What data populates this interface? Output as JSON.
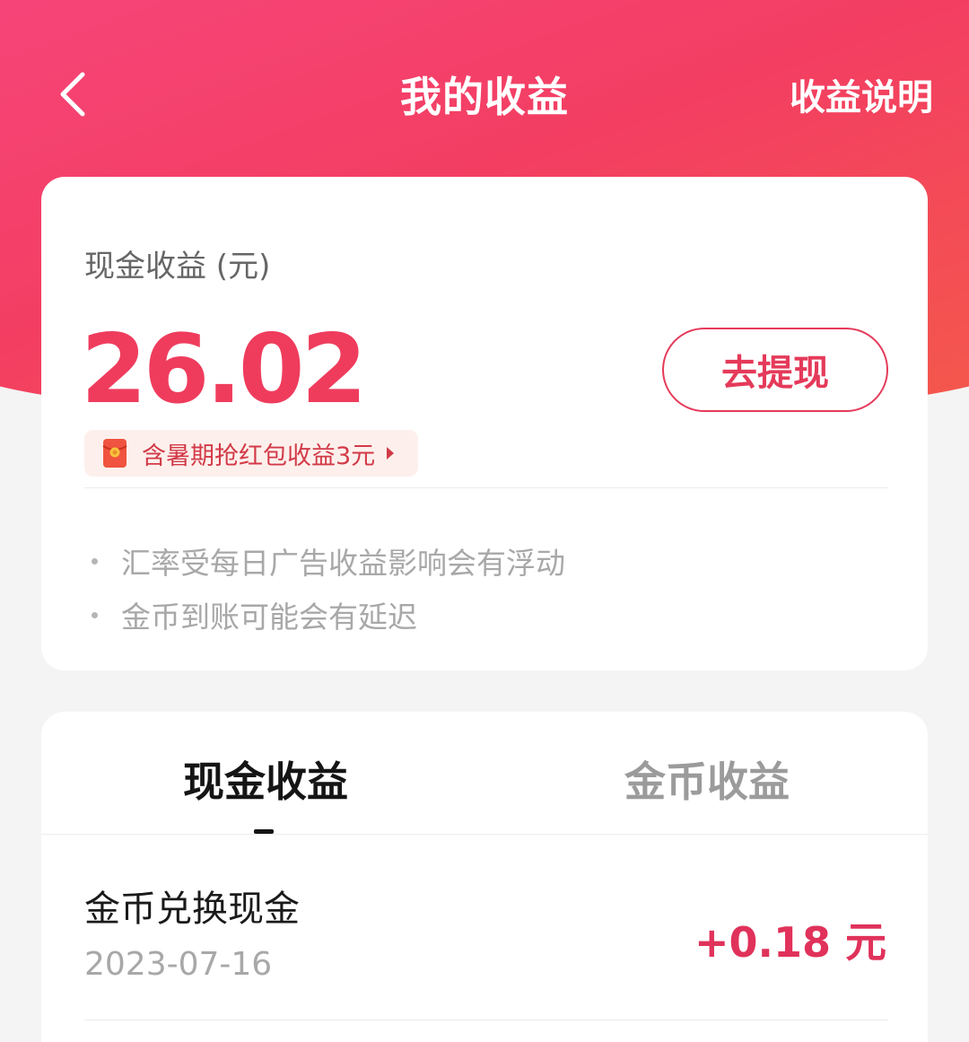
{
  "header": {
    "title": "我的收益",
    "help_label": "收益说明",
    "back_icon": "chevron-left-icon"
  },
  "summary": {
    "balance_label": "现金收益 (元)",
    "balance_value": "26.02",
    "withdraw_label": "去提现",
    "bonus_text": "含暑期抢红包收益3元",
    "bonus_icon": "red-envelope-icon",
    "notes": [
      "汇率受每日广告收益影响会有浮动",
      "金币到账可能会有延迟"
    ]
  },
  "tabs": [
    {
      "label": "现金收益",
      "active": true
    },
    {
      "label": "金币收益",
      "active": false
    }
  ],
  "records": [
    {
      "title": "金币兑换现金",
      "date": "2023-07-16",
      "amount": "+0.18 元"
    }
  ],
  "colors": {
    "accent": "#ef3c5d",
    "header_gradient_start": "#f6457a",
    "header_gradient_end": "#f45a4a"
  }
}
